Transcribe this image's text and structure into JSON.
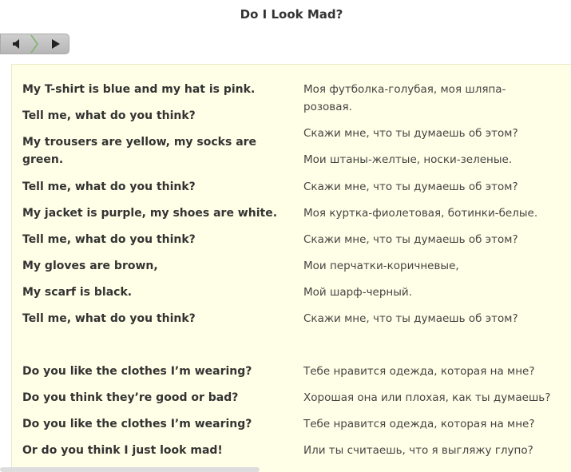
{
  "title": "Do I Look Mad?",
  "player": {
    "speaker_icon": "speaker-icon",
    "separator_icon": "chevron-right-icon",
    "play_icon": "play-icon"
  },
  "colors": {
    "panel_background": "#ffffe7",
    "player_background": "#c0c0c0",
    "chevron": "#7ab46b"
  },
  "lyrics": {
    "en": [
      "My T-shirt is blue and my hat is pink.",
      "Tell me, what do you think?",
      "My trousers are yellow, my socks are green.",
      "Tell me, what do you think?",
      "My jacket is purple, my shoes are white.",
      "Tell me, what do you think?",
      "My gloves are brown,",
      "My scarf is black.",
      "Tell me, what do you think?",
      "Do you like the clothes I’m wearing?",
      "Do you think they’re good or bad?",
      "Do you like the clothes I’m wearing?",
      "Or do you think I just look mad!"
    ],
    "ru": [
      "Моя футболка-голубая, моя шляпа-розовая.",
      "Скажи мне, что ты думаешь об этом?",
      "Мои штаны-желтые, носки-зеленые.",
      "Скажи мне, что ты думаешь об этом?",
      "Моя куртка-фиолетовая, ботинки-белые.",
      "Скажи мне, что ты думаешь об этом?",
      "Мои перчатки-коричневые,",
      "Мой шарф-черный.",
      "Скажи мне, что ты думаешь об этом?",
      "Тебе нравится одежда, которая на мне?",
      "Хорошая она или плохая, как ты думаешь?",
      "Тебе нравится одежда, которая на мне?",
      "Или ты считаешь, что я выгляжу глупо?"
    ]
  }
}
